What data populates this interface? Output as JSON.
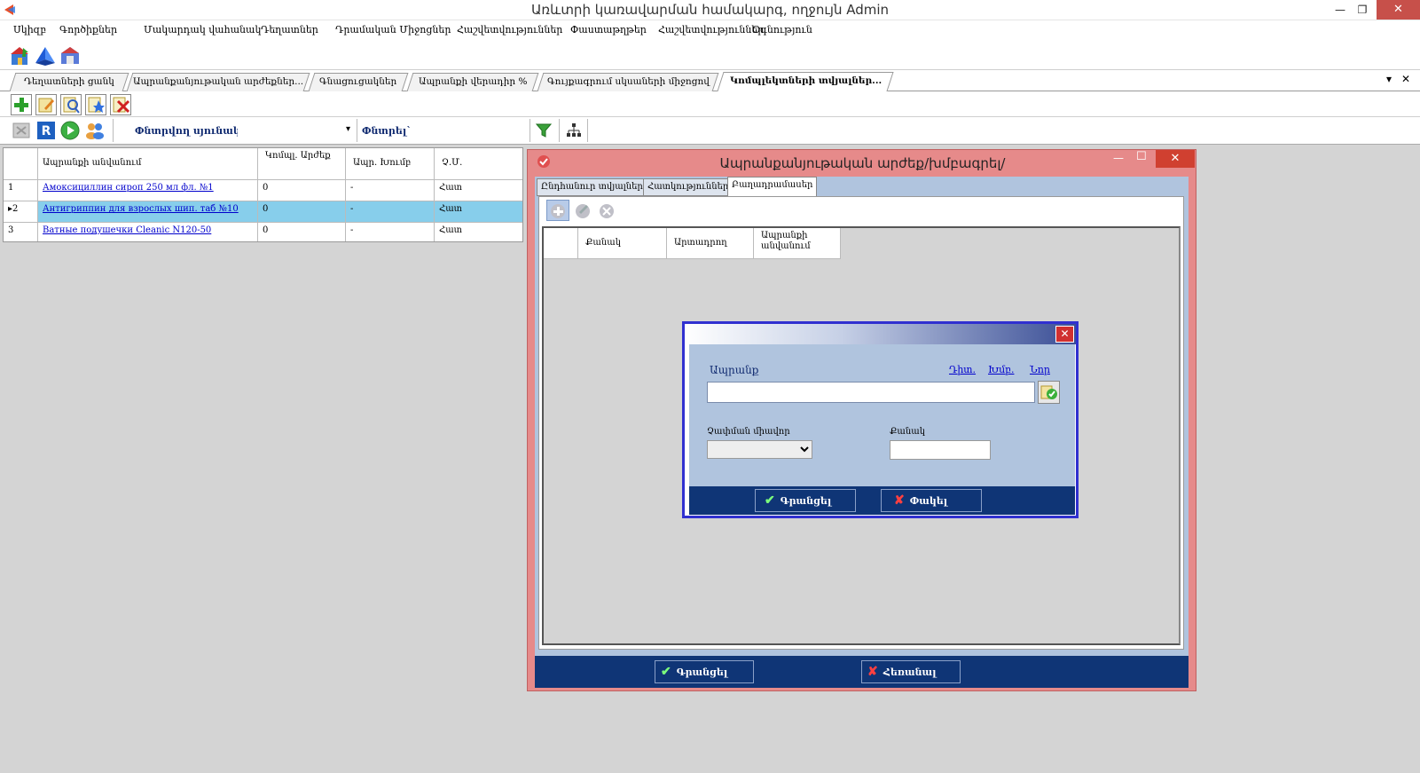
{
  "window": {
    "title": "Առևտրի կառավարման համակարգ, ողջույն Admin",
    "minimize_glyph": "—",
    "restore_glyph": "❐",
    "close_glyph": "✕"
  },
  "menu": [
    "Սկիզբ",
    "Գործիքներ",
    "Մակարդակ վահանակ",
    "Դեղատներ",
    "Դրամական Միջոցներ",
    "Հաշվետվություններ",
    "Փաստաթղթեր",
    "Հաշվետվություններ",
    "Օգնություն"
  ],
  "doc_tabs": [
    "Դեղատների ցանկ",
    "Ապրանքանյութական արժեքներ...",
    "Գնացուցակներ",
    "Ապրանքի վերադիր %",
    "Գույքագրում սկսաների միջոցով",
    "Կոմպլեկտների տվյալներ..."
  ],
  "doc_tabs_controls": {
    "dropdown": "▾",
    "close": "✕"
  },
  "toolbar3": {
    "search_field_label": "Փնտրվող սյունակ`",
    "search_label": "Փնտրել`",
    "dropdown_arrow": "▾"
  },
  "grid": {
    "headers": [
      "",
      "Ապրանքի անվանում",
      "Կոմպլ. Արժեք",
      "Ապր. Խումբ",
      "Չ.Մ."
    ],
    "rows": [
      {
        "num": "1",
        "name": "Амоксициллин сироп 250 мл фл. №1",
        "value": "0",
        "group": "-",
        "unit": "Հատ"
      },
      {
        "num": "2",
        "name": "Антигриппин для взрослых шип. таб №10",
        "value": "0",
        "group": "-",
        "unit": "Հատ"
      },
      {
        "num": "3",
        "name": "Ватные подушечки Cleanic N120-50",
        "value": "0",
        "group": "-",
        "unit": "Հատ"
      }
    ],
    "current_row_marker": "▸"
  },
  "modal1": {
    "title": "Ապրանքանյութական արժեք/խմբագրել/",
    "minimize": "—",
    "maximize": "☐",
    "close": "✕",
    "tabs": [
      "Ընդհանուր տվյալներ",
      "Հատկություններ",
      "Բաղադրամասեր"
    ],
    "subgrid_headers": [
      "",
      "Քանակ",
      "Արտադրող",
      "Ապրանքի անվանում"
    ],
    "confirm": "Գրանցել",
    "cancel": "Հեռանալ",
    "confirm_glyph": "✔",
    "cancel_glyph": "✘"
  },
  "modal2": {
    "product_label": "Ապրանք",
    "links": [
      "Դիտ.",
      "Խմբ.",
      "Նոր"
    ],
    "unit_label": "Չափման միավոր",
    "qty_label": "Քանակ",
    "product_value": "",
    "qty_value": "",
    "unit_value": "",
    "confirm": "Գրանցել",
    "cancel": "Փակել",
    "confirm_glyph": "✔",
    "cancel_glyph": "✘",
    "close_glyph": "✕"
  },
  "colors": {
    "accent_navy": "#0f3576",
    "modal_pink": "#e68a8a",
    "panel_blue": "#b0c4de",
    "selected_row": "#87ceeb",
    "link": "#0000cc"
  }
}
